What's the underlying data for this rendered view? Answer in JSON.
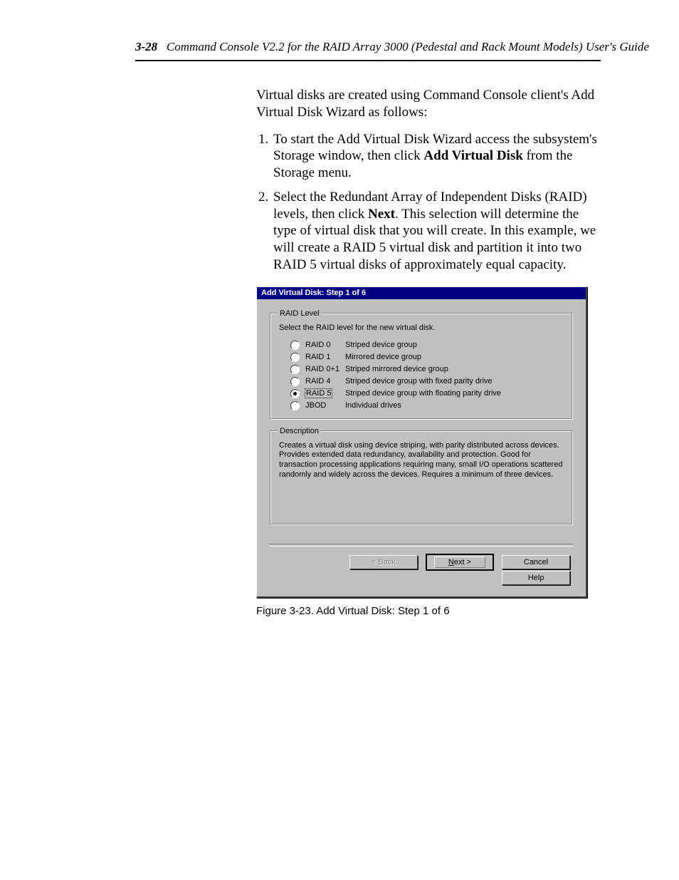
{
  "header": {
    "page_number": "3-28",
    "title": "Command Console V2.2 for the RAID Array 3000 (Pedestal and Rack Mount Models) User's Guide"
  },
  "body": {
    "intro": "Virtual disks are created using Command Console client's Add Virtual Disk Wizard as follows:",
    "step1_a": "To start the Add Virtual Disk Wizard access the subsystem's Storage window, then click ",
    "step1_bold": "Add Virtual Disk",
    "step1_b": " from the Storage menu.",
    "step2_a": "Select the Redundant Array of Independent Disks (RAID) levels, then click ",
    "step2_bold": "Next",
    "step2_b": ". This selection will determine the type of virtual disk that you will create. In this example, we will create a RAID 5 virtual disk and partition it into two RAID 5 virtual disks of approximately equal capacity."
  },
  "dialog": {
    "title": "Add Virtual Disk: Step 1 of 6",
    "group_raid": "RAID Level",
    "raid_instruction": "Select the RAID level for the new virtual disk.",
    "options": [
      {
        "label": "RAID 0",
        "desc": "Striped device group",
        "selected": false
      },
      {
        "label": "RAID 1",
        "desc": "Mirrored device group",
        "selected": false
      },
      {
        "label": "RAID 0+1",
        "desc": "Striped mirrored device group",
        "selected": false
      },
      {
        "label": "RAID 4",
        "desc": "Striped device group with fixed parity drive",
        "selected": false
      },
      {
        "label": "RAID 5",
        "desc": "Striped device group with floating parity drive",
        "selected": true
      },
      {
        "label": "JBOD",
        "desc": "Individual drives",
        "selected": false
      }
    ],
    "group_desc": "Description",
    "description_text": "Creates a virtual disk using device striping, with parity distributed across devices.  Provides extended data redundancy, availability and protection.  Good for transaction processing applications requiring many, small I/O operations scattered randomly and widely across the devices.  Requires a minimum of three devices.",
    "buttons": {
      "back": "< Back",
      "next_u": "N",
      "next_r": "ext >",
      "cancel": "Cancel",
      "help": "Help"
    }
  },
  "caption": "Figure 3-23.  Add Virtual Disk: Step 1 of 6"
}
